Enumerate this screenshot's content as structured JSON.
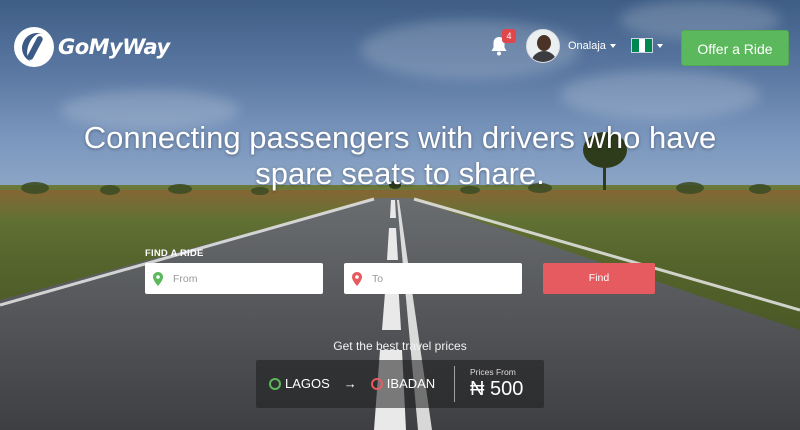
{
  "brand": {
    "name": "GoMyWay"
  },
  "header": {
    "notifications_count": "4",
    "username": "Onalaja",
    "country_flag": {
      "colors": [
        "#008751",
        "#ffffff",
        "#008751"
      ]
    },
    "offer_ride_label": "Offer a Ride"
  },
  "hero": {
    "title": "Connecting passengers with drivers who have spare seats to share."
  },
  "search": {
    "section_label": "FIND A RIDE",
    "from_placeholder": "From",
    "to_placeholder": "To",
    "find_label": "Find"
  },
  "promo": {
    "heading": "Get the best travel prices",
    "origin": "LAGOS",
    "arrow": "→",
    "destination": "IBADAN",
    "price_label": "Prices From",
    "price": "₦ 500"
  },
  "colors": {
    "accent_green": "#5cb85c",
    "accent_red": "#e65b5f",
    "badge_red": "#e0464a"
  },
  "icons": [
    "logo-icon",
    "bell-icon",
    "avatar",
    "nigeria-flag-icon",
    "map-pin-icon"
  ]
}
